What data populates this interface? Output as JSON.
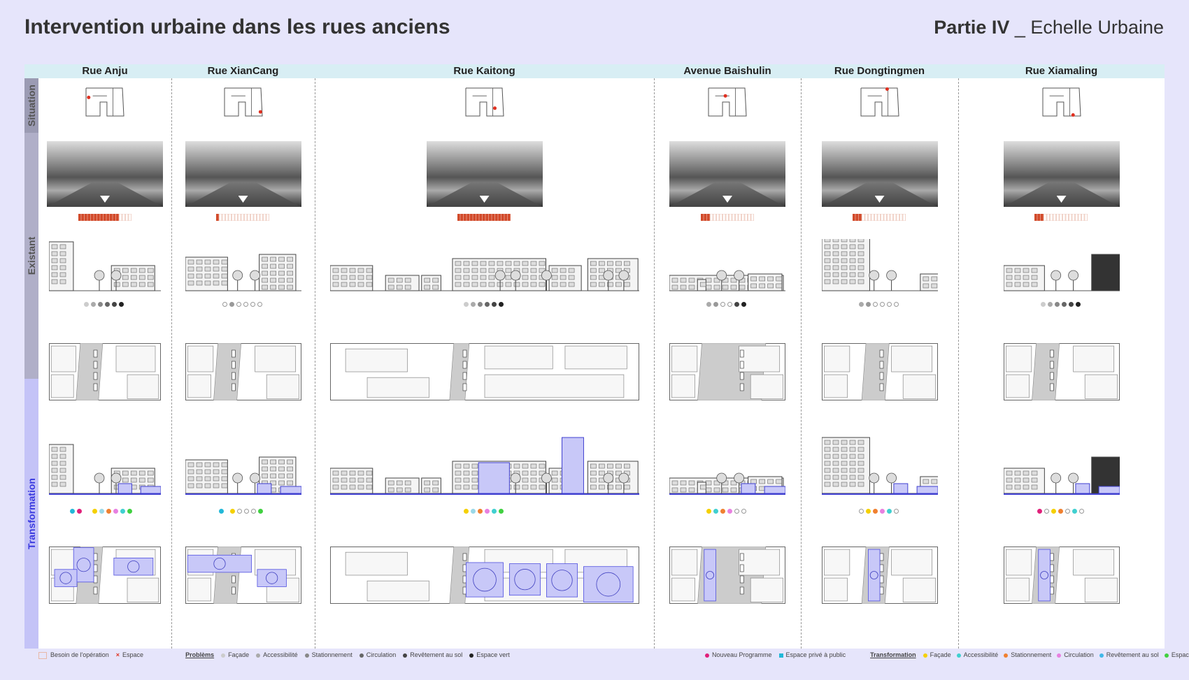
{
  "header": {
    "title": "Intervention urbaine dans les rues anciens",
    "part_bold": "Partie IV",
    "part_rest": " _ Echelle Urbaine"
  },
  "sections": [
    {
      "label": "Situation",
      "color": "#9b9bb3"
    },
    {
      "label": "Existant",
      "color": "#9b9bb3"
    },
    {
      "label": "Transformation",
      "color": "#3a3ae0"
    }
  ],
  "streets": [
    {
      "name": "Rue Anju",
      "bars_filled": 13,
      "bars_total": 17,
      "dots_exist": [
        "#ccc",
        "#aaa",
        "#888",
        "#666",
        "#444",
        "#222"
      ],
      "dots_trans": [
        "#22b8d8",
        "#e0207a",
        "",
        "",
        "#f5d000",
        "#9ad8e8",
        "#f08030",
        "#e880e0",
        "#40d0d0",
        "#40d040"
      ]
    },
    {
      "name": "Rue XianCang",
      "bars_filled": 1,
      "bars_total": 17,
      "dots_exist": [
        "empty",
        "#999",
        "empty",
        "empty",
        "empty",
        "empty"
      ],
      "dots_trans": [
        "#22b8d8",
        "",
        "#f5d000",
        "empty",
        "empty",
        "empty",
        "#40d040"
      ]
    },
    {
      "name": "Rue Kaitong",
      "bars_filled": 17,
      "bars_total": 17,
      "dots_exist": [
        "#ccc",
        "#aaa",
        "#888",
        "#666",
        "#444",
        "#222"
      ],
      "dots_trans": [
        "#f5d000",
        "#9ad8e8",
        "#f08030",
        "#e880e0",
        "#40d0d0",
        "#40d040"
      ]
    },
    {
      "name": "Avenue Baishulin",
      "bars_filled": 3,
      "bars_total": 17,
      "dots_exist": [
        "#aaa",
        "#999",
        "empty",
        "empty",
        "#444",
        "#222"
      ],
      "dots_trans": [
        "#f5d000",
        "#40d0d0",
        "#f08030",
        "#e880e0",
        "empty",
        "empty"
      ]
    },
    {
      "name": "Rue Dongtingmen",
      "bars_filled": 3,
      "bars_total": 17,
      "dots_exist": [
        "#aaa",
        "#999",
        "empty",
        "empty",
        "empty",
        "empty"
      ],
      "dots_trans": [
        "empty",
        "#f5d000",
        "#f08030",
        "#e880e0",
        "#40d0d0",
        "empty"
      ]
    },
    {
      "name": "Rue Xiamaling",
      "bars_filled": 3,
      "bars_total": 17,
      "dots_exist": [
        "#ccc",
        "#aaa",
        "#888",
        "#666",
        "#444",
        "#222"
      ],
      "dots_trans": [
        "#e0207a",
        "empty",
        "#f5d000",
        "#f08030",
        "empty",
        "#40d0d0",
        "empty"
      ]
    }
  ],
  "legend_left": {
    "besoin": "Besoin de l'opération",
    "espace": "Espace",
    "problems_title": "Problèms",
    "items": [
      {
        "label": "Façade",
        "color": "#ccc"
      },
      {
        "label": "Accessibilité",
        "color": "#aaa"
      },
      {
        "label": "Stationnement",
        "color": "#888"
      },
      {
        "label": "Circulation",
        "color": "#666"
      },
      {
        "label": "Revêtement au sol",
        "color": "#444"
      },
      {
        "label": "Espace vert",
        "color": "#222"
      }
    ]
  },
  "legend_right": {
    "items_pre": [
      {
        "label": "Nouveau Programme",
        "color": "#e0207a"
      },
      {
        "label": "Espace privé à public",
        "color": "#22b8d8"
      }
    ],
    "trans_title": "Transformation",
    "items": [
      {
        "label": "Façade",
        "color": "#f5d000"
      },
      {
        "label": "Accessibilité",
        "color": "#40d0d0"
      },
      {
        "label": "Stationnement",
        "color": "#f08030"
      },
      {
        "label": "Circulation",
        "color": "#e880e0"
      },
      {
        "label": "Revêtement au sol",
        "color": "#40b8e8"
      },
      {
        "label": "Espace vert",
        "color": "#40d040"
      }
    ]
  },
  "colors": {
    "bar_on": "#d24a2a",
    "bar_off": "#e8b8a8",
    "accent": "#8080f0",
    "fill_light": "#c8c8f8"
  }
}
